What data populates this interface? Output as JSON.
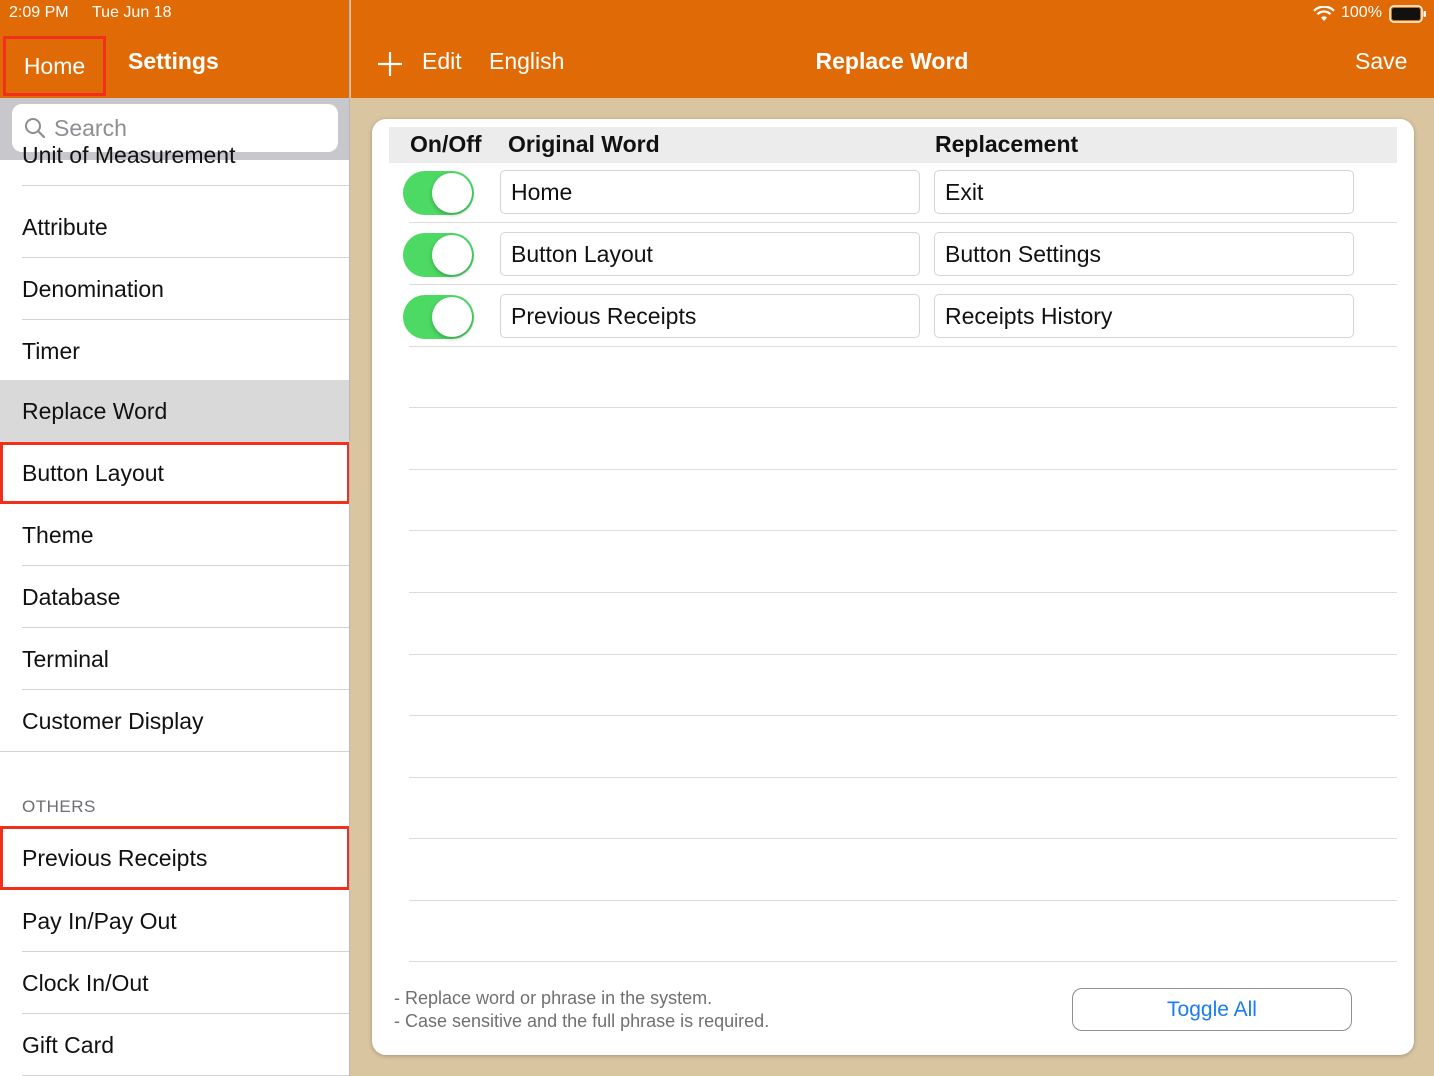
{
  "status_bar": {
    "time": "2:09 PM",
    "date": "Tue Jun 18",
    "battery": "100%",
    "icons": [
      "wifi-icon",
      "battery-icon"
    ]
  },
  "left_nav": {
    "home_label": "Home",
    "title": "Settings"
  },
  "search": {
    "placeholder": "Search"
  },
  "sidebar": {
    "items": [
      {
        "label": "Unit of Measurement"
      },
      {
        "label": "Attribute"
      },
      {
        "label": "Denomination"
      },
      {
        "label": "Timer"
      },
      {
        "label": "Replace Word"
      },
      {
        "label": "Button Layout"
      },
      {
        "label": "Theme"
      },
      {
        "label": "Database"
      },
      {
        "label": "Terminal"
      },
      {
        "label": "Customer Display"
      }
    ],
    "others_label": "OTHERS",
    "others": [
      {
        "label": "Previous Receipts"
      },
      {
        "label": "Pay In/Pay Out"
      },
      {
        "label": "Clock In/Out"
      },
      {
        "label": "Gift Card"
      }
    ]
  },
  "toolbar": {
    "edit_label": "Edit",
    "language_label": "English",
    "title": "Replace Word",
    "save_label": "Save"
  },
  "table": {
    "headers": {
      "onoff": "On/Off",
      "original": "Original Word",
      "replacement": "Replacement"
    },
    "rows": [
      {
        "enabled": true,
        "original": "Home",
        "replacement": "Exit"
      },
      {
        "enabled": true,
        "original": "Button Layout",
        "replacement": "Button Settings"
      },
      {
        "enabled": true,
        "original": "Previous Receipts",
        "replacement": "Receipts History"
      }
    ]
  },
  "footer": {
    "notes": [
      "- Replace word or phrase in the system.",
      "- Case sensitive and the full phrase is required."
    ],
    "toggle_all_label": "Toggle All"
  },
  "colors": {
    "accent": "#e06b06",
    "toggle_on": "#4cd964",
    "highlight": "#f0301a",
    "link": "#1a7cf0"
  }
}
